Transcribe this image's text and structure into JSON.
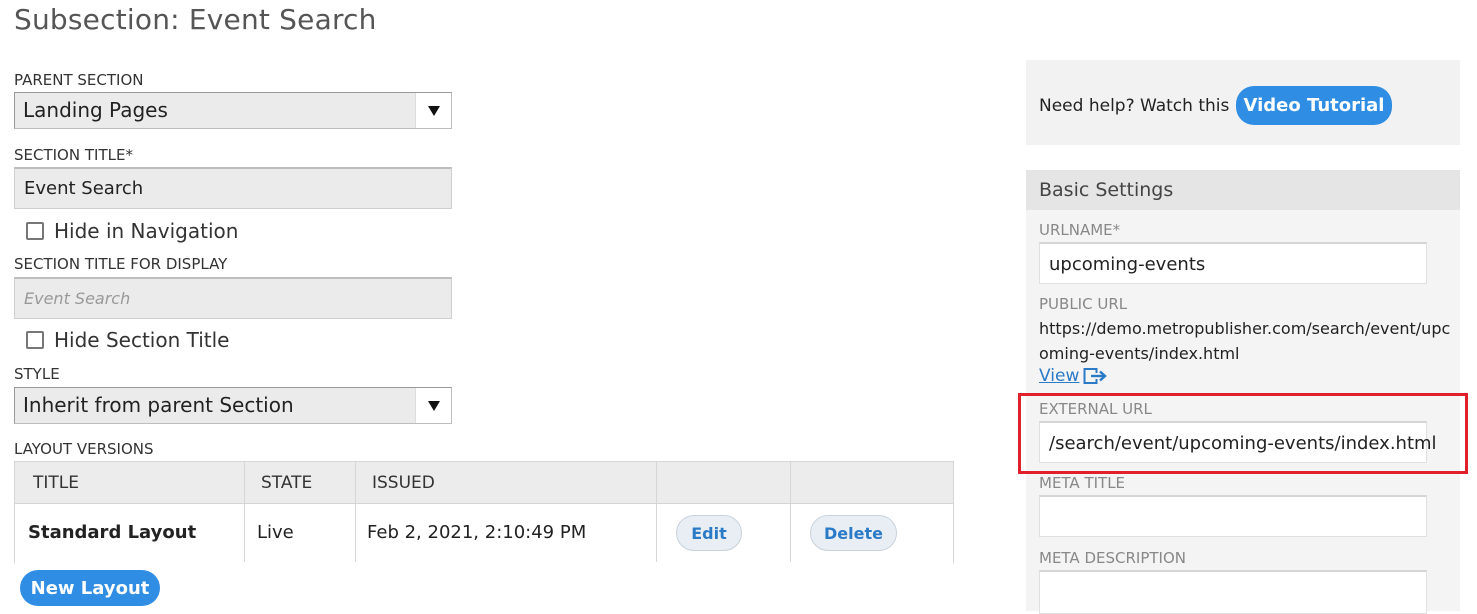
{
  "page": {
    "title": "Subsection: Event Search"
  },
  "form": {
    "parent_section_label": "PARENT SECTION",
    "parent_section_value": "Landing Pages",
    "section_title_label": "SECTION TITLE*",
    "section_title_value": "Event Search",
    "hide_in_nav_label": "Hide in Navigation",
    "hide_in_nav_checked": false,
    "display_title_label": "SECTION TITLE FOR DISPLAY",
    "display_title_placeholder": "Event Search",
    "hide_title_label": "Hide Section Title",
    "hide_title_checked": false,
    "style_label": "STYLE",
    "style_value": "Inherit from parent Section"
  },
  "layout_versions": {
    "label": "LAYOUT VERSIONS",
    "columns": [
      "TITLE",
      "STATE",
      "ISSUED"
    ],
    "rows": [
      {
        "title": "Standard Layout",
        "state": "Live",
        "issued": "Feb 2, 2021, 2:10:49 PM",
        "edit": "Edit",
        "delete": "Delete"
      }
    ],
    "new_layout_button": "New Layout"
  },
  "help": {
    "text": "Need help? Watch this",
    "button": "Video Tutorial"
  },
  "basic_settings": {
    "title": "Basic Settings",
    "urlname_label": "URLNAME*",
    "urlname_value": "upcoming-events",
    "public_url_label": "PUBLIC URL",
    "public_url_value": "https://demo.metropublisher.com/search/event/upcoming-events/index.html",
    "view_link": "View",
    "external_url_label": "EXTERNAL URL",
    "external_url_value": "/search/event/upcoming-events/index.html",
    "meta_title_label": "META TITLE",
    "meta_title_value": "",
    "meta_description_label": "META DESCRIPTION",
    "meta_description_value": ""
  },
  "colors": {
    "primary": "#2f8de3",
    "highlight": "#e0202b",
    "link": "#2a7ac7"
  }
}
